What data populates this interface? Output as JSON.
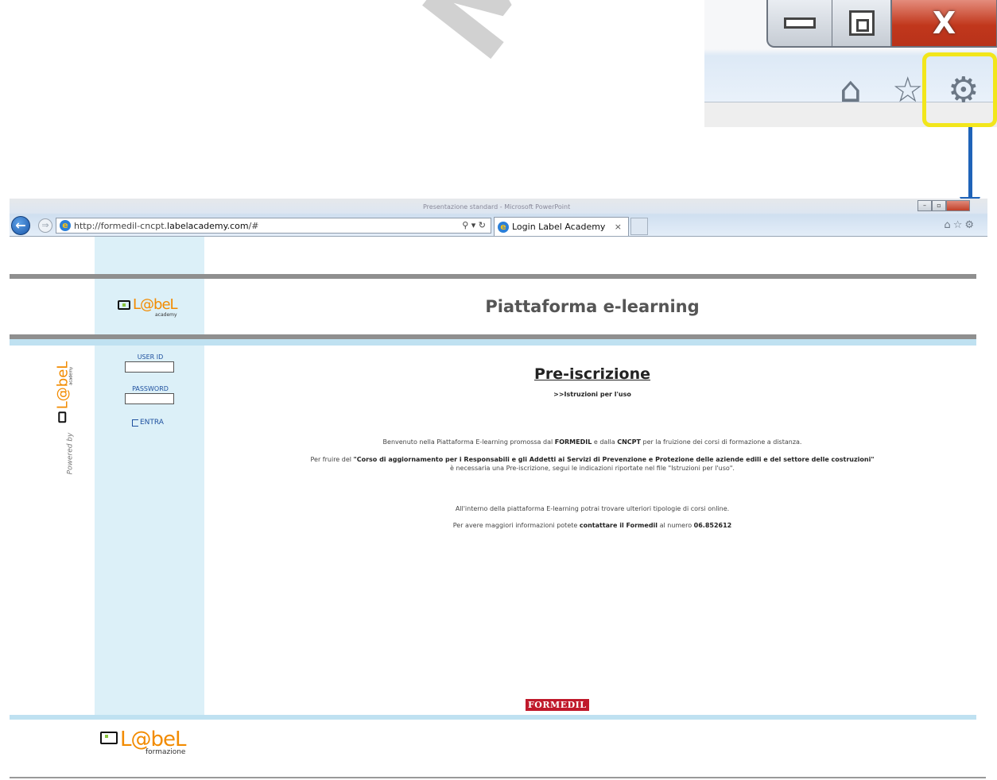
{
  "browser": {
    "url_prefix": "http://formedil-cncpt.",
    "url_domain": "labelacademy.com",
    "url_suffix": "/#",
    "addr_tools": "⚲ ▾ ↻",
    "tab_title": "Login Label Academy",
    "tab_close": "×",
    "title_bar_text": "Presentazione standard - Microsoft PowerPoint",
    "toolbar_icons": [
      "home-icon",
      "star-icon",
      "gear-icon"
    ]
  },
  "zoom_callout": {
    "close_glyph": "X",
    "icons": [
      "home-icon",
      "star-icon",
      "gear-icon"
    ],
    "highlight_color": "#f2e61b",
    "arrow_color": "#1f63b8"
  },
  "header": {
    "logo_word": "L@beL",
    "logo_sub": "academy",
    "title": "Piattaforma e-learning"
  },
  "sidebar": {
    "powered_by": "Powered by",
    "vlogo_word": "L@beL",
    "vlogo_sub": "academy"
  },
  "login": {
    "user_label": "USER ID",
    "user_value": "",
    "password_label": "PASSWORD",
    "password_value": "",
    "enter_label": "ENTRA"
  },
  "main": {
    "pre_title": "Pre-iscrizione",
    "instructions": ">>Istruzioni per l'uso",
    "welcome_1": "Benvenuto nella Piattaforma E-learning promossa dal ",
    "welcome_b1": "FORMEDIL",
    "welcome_2": " e dalla ",
    "welcome_b2": "CNCPT",
    "welcome_3": " per la fruizione dei corsi di formazione a distanza.",
    "course_1": "Per fruire del ",
    "course_b": "\"Corso di aggiornamento per i Responsabili e gli Addetti ai Servizi di Prevenzione e Protezione delle aziende edili e del settore delle costruzioni\"",
    "course_2": "è necessaria una Pre-iscrizione, segui le indicazioni riportate nel file \"Istruzioni per l'uso\".",
    "inside": "All'interno della piattaforma E-learning potrai trovare ulteriori tipologie di corsi online.",
    "info_1": "Per avere maggiori informazioni potete ",
    "info_b1": "contattare il Formedil",
    "info_2": " al numero ",
    "info_b2": "06.852612"
  },
  "footer": {
    "formedil_badge": "FORMEDIL",
    "logo_word": "L@beL",
    "logo_sub": "formazione"
  },
  "watermark": "MAZIO"
}
